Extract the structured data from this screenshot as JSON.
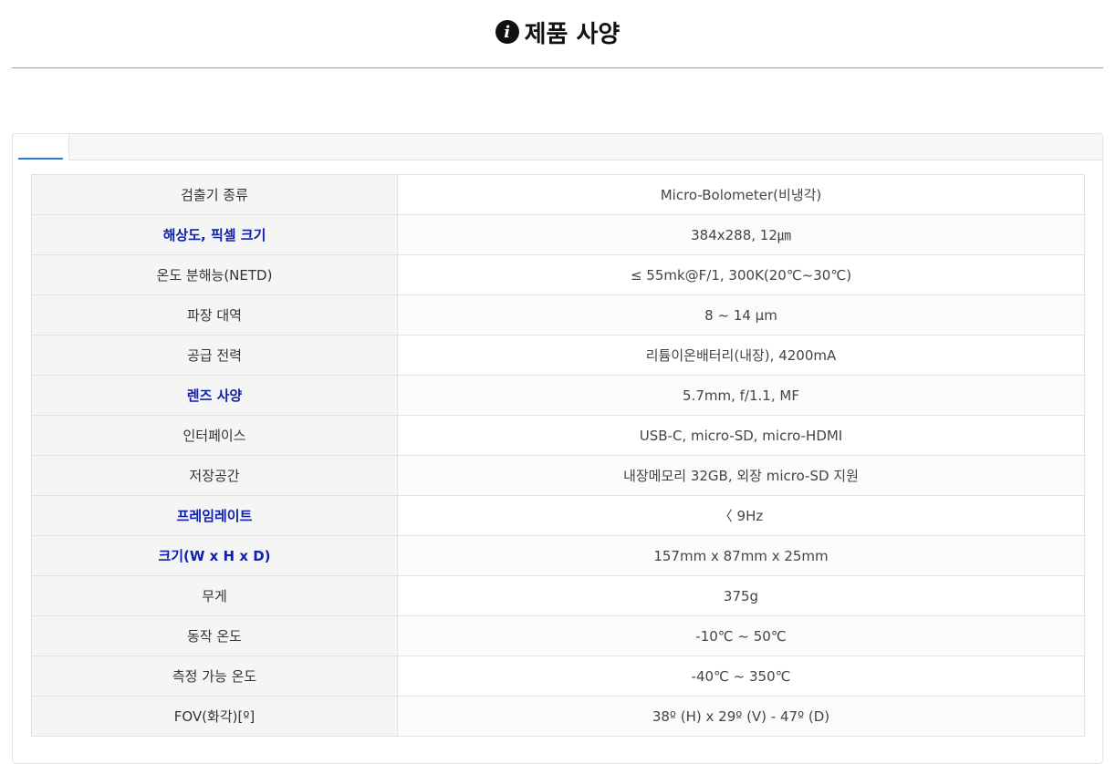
{
  "page": {
    "title": "제품 사양",
    "title_icon": "info-circle-icon"
  },
  "tabs": [
    {
      "label": ""
    }
  ],
  "specs": [
    {
      "label": "검출기 종류",
      "value": "Micro-Bolometer(비냉각)",
      "highlight": false
    },
    {
      "label": "해상도, 픽셀 크기",
      "value": "384x288, 12㎛",
      "highlight": true
    },
    {
      "label": "온도 분해능(NETD)",
      "value": "≤ 55mk@F/1, 300K(20℃~30℃)",
      "highlight": false
    },
    {
      "label": "파장 대역",
      "value": "8 ~ 14 μm",
      "highlight": false
    },
    {
      "label": "공급 전력",
      "value": "리튬이온배터리(내장), 4200mA",
      "highlight": false
    },
    {
      "label": "렌즈 사양",
      "value": "5.7mm, f/1.1, MF",
      "highlight": true
    },
    {
      "label": "인터페이스",
      "value": "USB-C, micro-SD, micro-HDMI",
      "highlight": false
    },
    {
      "label": "저장공간",
      "value": "내장메모리 32GB, 외장 micro-SD 지원",
      "highlight": false
    },
    {
      "label": "프레임레이트",
      "value": "〈 9Hz",
      "highlight": true
    },
    {
      "label": "크기(W x H x D)",
      "value": "157mm x 87mm x 25mm",
      "highlight": true
    },
    {
      "label": "무게",
      "value": "375g",
      "highlight": false
    },
    {
      "label": "동작 온도",
      "value": "-10℃ ~ 50℃",
      "highlight": false
    },
    {
      "label": "측정 가능 온도",
      "value": "-40℃ ~ 350℃",
      "highlight": false
    },
    {
      "label": "FOV(화각)[º]",
      "value": "38º (H) x 29º (V) - 47º (D)",
      "highlight": false
    }
  ],
  "colors": {
    "highlight_label": "#1020a8",
    "tab_underline": "#2a7ad8"
  }
}
